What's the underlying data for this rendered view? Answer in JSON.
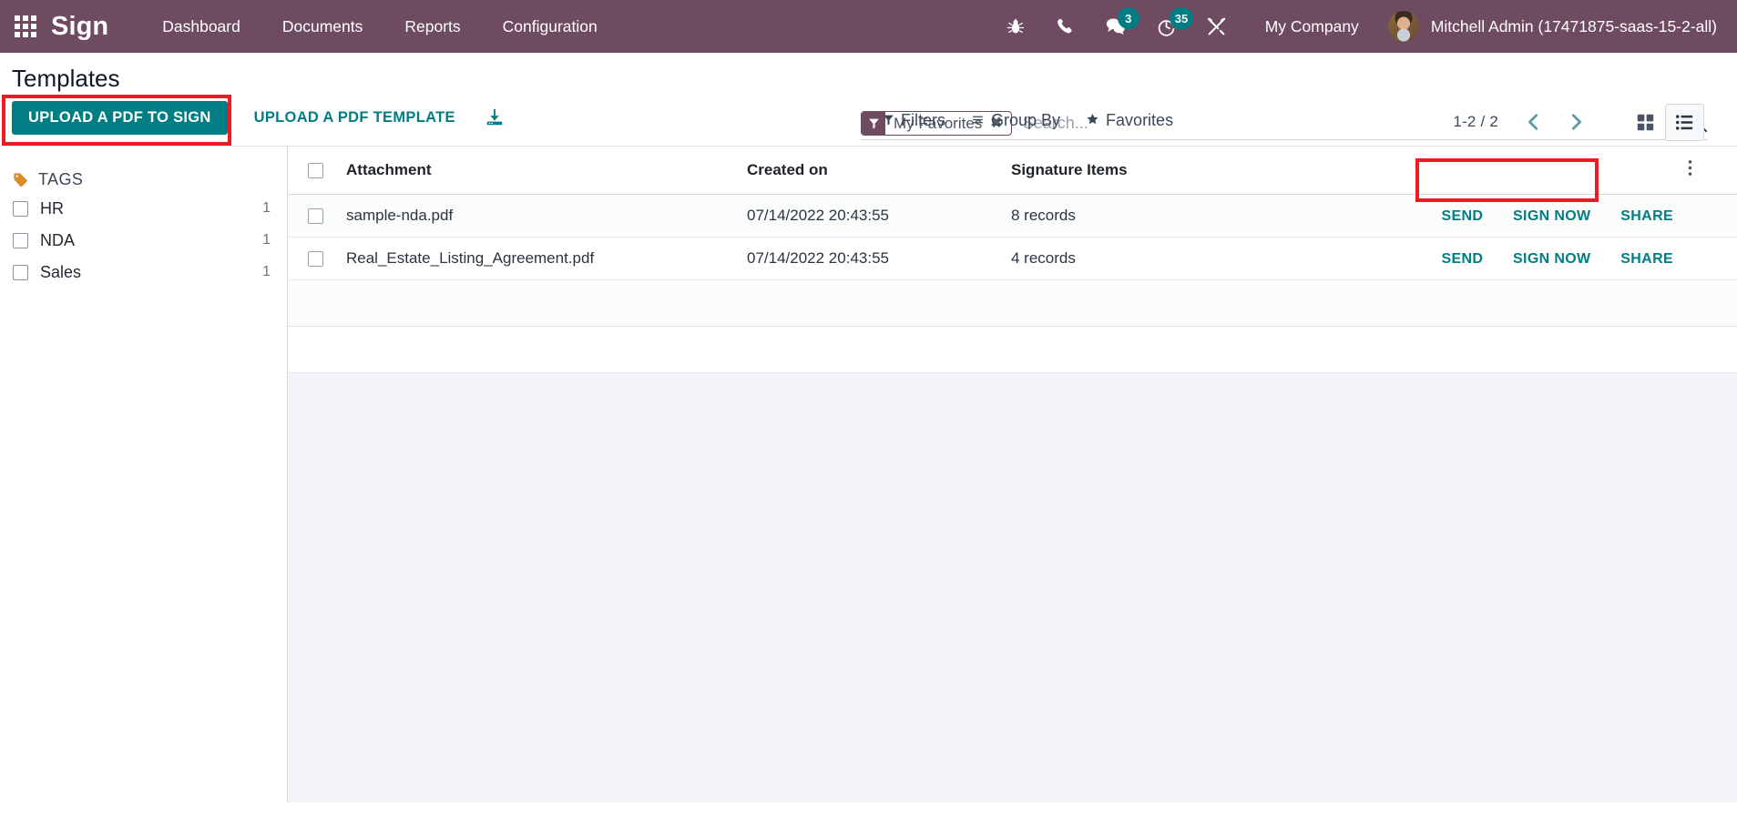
{
  "navbar": {
    "apps_icon": "apps-grid-icon",
    "brand": "Sign",
    "menu_items": [
      "Dashboard",
      "Documents",
      "Reports",
      "Configuration"
    ],
    "icons": [
      {
        "name": "bug-icon",
        "badge": null
      },
      {
        "name": "phone-icon",
        "badge": null
      },
      {
        "name": "messages-icon",
        "badge": "3"
      },
      {
        "name": "activities-clock-icon",
        "badge": "35"
      },
      {
        "name": "tools-icon",
        "badge": null
      }
    ],
    "company": "My Company",
    "user_name": "Mitchell Admin (17471875-saas-15-2-all)"
  },
  "control_panel": {
    "title": "Templates",
    "buttons": {
      "upload_pdf_to_sign": "UPLOAD A PDF TO SIGN",
      "upload_pdf_template": "UPLOAD A PDF TEMPLATE",
      "import_icon": "import-download-icon"
    },
    "search": {
      "facet_label": "My Favorites",
      "facet_icon": "filter-funnel-icon",
      "facet_remove_icon": "close-x-icon",
      "placeholder": "Search...",
      "value": "",
      "search_icon": "search-magnifier-icon"
    },
    "dropdowns": [
      {
        "label": "Filters",
        "icon": "filter-funnel-icon"
      },
      {
        "label": "Group By",
        "icon": "hamburger-lines-icon"
      },
      {
        "label": "Favorites",
        "icon": "star-icon"
      }
    ],
    "pager": {
      "range": "1-2 / 2",
      "previous_icon": "chevron-left-icon",
      "next_icon": "chevron-right-icon"
    },
    "view_switcher": [
      {
        "name": "kanban-view-icon",
        "active": false
      },
      {
        "name": "list-view-icon",
        "active": true
      }
    ]
  },
  "sidebar": {
    "section_title": "TAGS",
    "section_icon": "tag-icon",
    "tags": [
      {
        "label": "HR",
        "count": "1"
      },
      {
        "label": "NDA",
        "count": "1"
      },
      {
        "label": "Sales",
        "count": "1"
      }
    ]
  },
  "list": {
    "columns": [
      "Attachment",
      "Created on",
      "Signature Items"
    ],
    "optional_columns_icon": "vertical-dots-icon",
    "rows": [
      {
        "attachment": "sample-nda.pdf",
        "created_on": "07/14/2022 20:43:55",
        "signature_items": "8 records",
        "actions": [
          "SEND",
          "SIGN NOW",
          "SHARE"
        ]
      },
      {
        "attachment": "Real_Estate_Listing_Agreement.pdf",
        "created_on": "07/14/2022 20:43:55",
        "signature_items": "4 records",
        "actions": [
          "SEND",
          "SIGN NOW",
          "SHARE"
        ]
      }
    ]
  },
  "colors": {
    "navbar_bg": "#6f4b62",
    "primary": "#017e84",
    "highlight": "#ed1c24",
    "tag_icon": "#d98c2b",
    "badge_bg": "#017e84"
  }
}
